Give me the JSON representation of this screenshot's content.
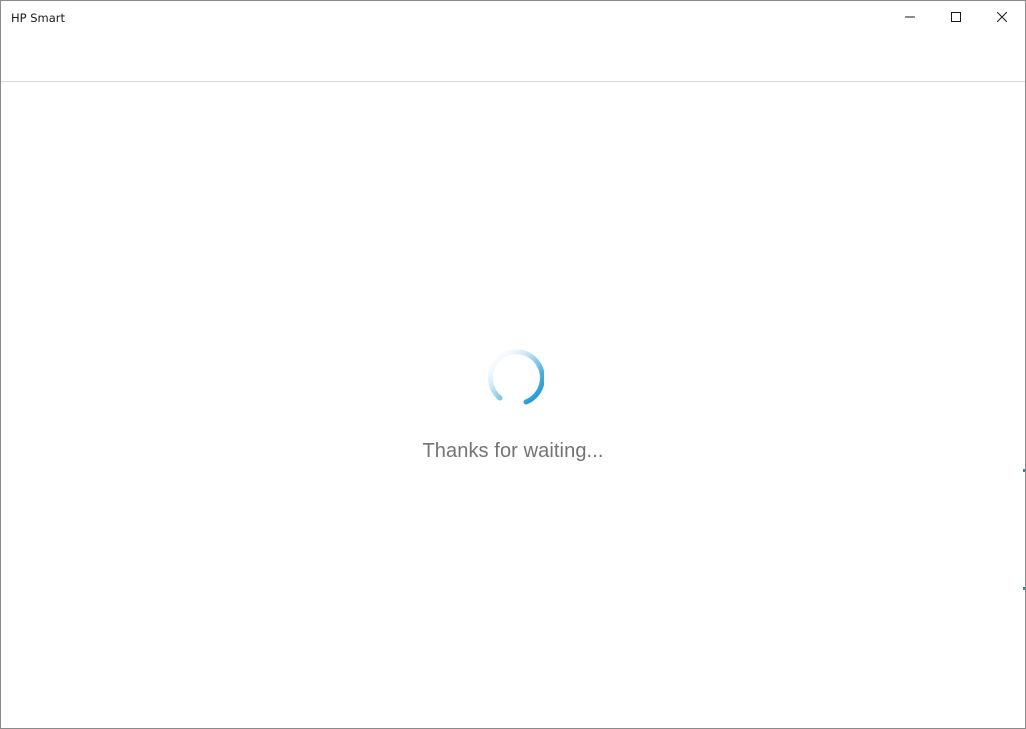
{
  "window": {
    "title": "HP Smart"
  },
  "caption_buttons": {
    "minimize": "minimize",
    "maximize": "maximize",
    "close": "close"
  },
  "loading": {
    "message": "Thanks for waiting...",
    "spinner_color": "#0e8fd1"
  }
}
